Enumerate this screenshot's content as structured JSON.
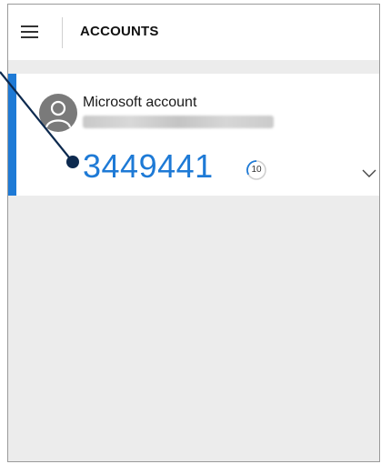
{
  "header": {
    "title": "ACCOUNTS",
    "menu_icon": "hamburger-menu-icon"
  },
  "account": {
    "name": "Microsoft account",
    "email_redacted": true,
    "avatar_icon": "person-avatar-icon",
    "code": "3449441",
    "timer_seconds": "10",
    "expand_icon": "chevron-down-icon"
  },
  "colors": {
    "accent": "#1e7ad6",
    "background": "#ececec",
    "card": "#ffffff",
    "avatar": "#7a7a7a",
    "callout": "#0d2a4f"
  }
}
